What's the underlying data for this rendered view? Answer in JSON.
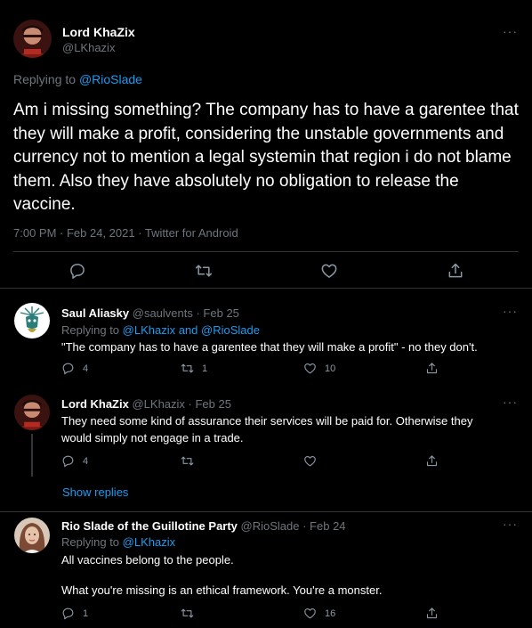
{
  "colors": {
    "background": "#000000",
    "text": "#ffffff",
    "muted": "#6e767d",
    "link": "#1d9bf0",
    "divider": "#2f3336"
  },
  "main_tweet": {
    "author_name": "Lord KhaZix",
    "author_handle": "@LKhazix",
    "replying_prefix": "Replying to",
    "replying_to": "@RioSlade",
    "text": "Am i missing something? The company has to have a garentee that they will make a profit, considering the unstable governments and currency not to mention a legal systemin that region i do not blame them. Also they have absolutely no obligation to release the vaccine.",
    "time": "7:00 PM · Feb 24, 2021 · ",
    "client": "Twitter for Android",
    "more_label": "···",
    "actions": [
      "reply-icon",
      "retweet-icon",
      "like-icon",
      "share-icon"
    ]
  },
  "replies": [
    {
      "author_name": "Saul Aliasky",
      "author_handle": "@saulvents",
      "date": " · Feb 25",
      "replying_prefix": "Replying to ",
      "replying_to": "@LKhazix and @RioSlade",
      "text": "\"The company has to have a garentee that they will make a profit\" - no they don't.",
      "reply_count": "4",
      "retweet_count": "1",
      "like_count": "10",
      "more_label": "···"
    },
    {
      "author_name": "Lord KhaZix",
      "author_handle": "@LKhazix",
      "date": " · Feb 25",
      "text": "They need some kind of assurance their services will be paid for. Otherwise they would simply not engage in a trade.",
      "reply_count": "4",
      "retweet_count": "",
      "like_count": "",
      "more_label": "···",
      "show_replies": "Show replies"
    },
    {
      "author_name": "Rio Slade of the Guillotine Party",
      "author_handle": "@RioSlade",
      "date": " · Feb 24",
      "replying_prefix": "Replying to ",
      "replying_to": "@LKhazix",
      "text_line1": "All vaccines belong to the people.",
      "text_line2": "What you're missing is an ethical framework. You're a monster.",
      "reply_count": "1",
      "retweet_count": "",
      "like_count": "16",
      "more_label": "···"
    }
  ]
}
